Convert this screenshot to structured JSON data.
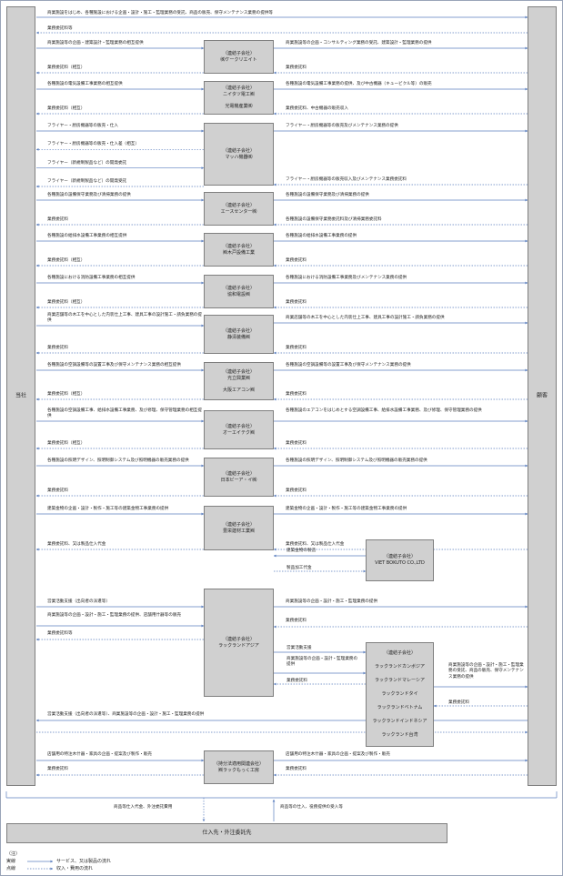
{
  "left_party": "当社",
  "right_party": "顧客",
  "blocks": [
    {
      "box": [],
      "left": [],
      "right": [],
      "top": [
        "商業施設をはじめ、各種施設における企画・設計・施工・監理業務の受託、商品の販売、保守メンテナンス業務の提供等"
      ],
      "bottom": [
        "業務委託料等"
      ]
    },
    {
      "box": [
        "（連結子会社）",
        "㈱ケークリエイト"
      ],
      "left": [
        "商業施設等の企画・建築設計・監理業務の相互提供",
        "業務委託料（相互）"
      ],
      "right": [
        "商業施設等の企画・コンサルティング業務の受託、建築設計・監理業務の提供",
        "業務委託料"
      ]
    },
    {
      "box": [
        "（連結子会社）",
        "ニイタツ電工㈱",
        "",
        "光電機産業㈱"
      ],
      "left": [
        "各種施設の電気設備工事業務の相互提供",
        "業務委託料（相互）"
      ],
      "right": [
        "各種施設の電気設備工事業務の提供、及び中古機器（キュービクル等）の販売",
        "業務委託料、中古機器の販売収入"
      ]
    },
    {
      "box": [
        "（連結子会社）",
        "マッハ機器㈱"
      ],
      "left": [
        "フライヤー・厨房機器等の販売・仕入",
        "フライヤー・厨房機器等の販売・仕入差（相互）",
        "フライヤー（新規制製品など）の開発委託",
        "フライヤー（新規制製品など）の開発受託"
      ],
      "right": [
        "フライヤー・厨房機器等の販売及びメンテナンス業務の提供",
        "フライヤー・厨房機器等の販売収入及びメンテナンス業務委託料"
      ]
    },
    {
      "box": [
        "（連結子会社）",
        "エースセンター㈱"
      ],
      "left": [
        "各種施設の設備保守業務及び清掃業務の提供",
        "業務委託料"
      ],
      "right": [
        "各種施設の設備保守業務及び清掃業務の提供",
        "各種施設の設備保守業務委託料及び清掃業務委託料"
      ]
    },
    {
      "box": [
        "（連結子会社）",
        "㈱木戸設備工業"
      ],
      "left": [
        "各種施設の給排水設備工事業務の相互提供",
        "業務委託料（相互）"
      ],
      "right": [
        "各種施設の給排水設備工事業務の提供",
        "業務委託料"
      ]
    },
    {
      "box": [
        "（連結子会社）",
        "協和電設㈱"
      ],
      "left": [
        "各種施設における消防設備工事業務の相互提供",
        "業務委託料（相互）"
      ],
      "right": [
        "各種施設における消防設備工事業務及びメンテナンス業務の提供",
        "業務委託料"
      ]
    },
    {
      "box": [
        "（連結子会社）",
        "静清装備㈱"
      ],
      "left": [
        "商業店舗等の木工を中心とした内装仕上工事、建具工事の設計施工・請負業務の提供",
        "業務委託料"
      ],
      "right": [
        "商業店舗等の木工を中心とした内装仕上工事、建具工事の設計施工・請負業務の提供",
        "業務委託料"
      ]
    },
    {
      "box": [
        "（連結子会社）",
        "光立興業㈱",
        "",
        "大阪エアコン㈱"
      ],
      "left": [
        "各種施設の空調設備等の設置工事及び保守メンテナンス業務の相互提供",
        "業務委託料（相互）"
      ],
      "right": [
        "各種施設の空調設備等の設置工事及び保守メンテナンス業務の提供",
        "業務委託料"
      ]
    },
    {
      "box": [
        "（連結子会社）",
        "オーエイテク㈱"
      ],
      "left": [
        "各種施設の空調設備工事、給排水設備工事業務、及び修理、保守管理業務の相互提供",
        "業務委託料（相互）"
      ],
      "right": [
        "各種施設のエアコンをはじめとする空調設備工事、給排水設備工事業務、及び修理、保守管理業務の提供",
        "業務委託料"
      ]
    },
    {
      "box": [
        "（連結子会社）",
        "日本ビーア・イ㈱"
      ],
      "left": [
        "各種施設の照明デザイン、照明制御システム及び照明機器の販売業務の提供",
        "業務委託料"
      ],
      "right": [
        "各種施設の照明デザイン、照明制御システム及び照明機器の販売業務の提供",
        "業務委託料"
      ]
    },
    {
      "box": [
        "（連結子会社）",
        "豊栄建材工業㈱"
      ],
      "left": [
        "建築金物の企画・設計・製作・施工等の建築金物工事業務の提供",
        "業務委託料、又は製品仕入代金"
      ],
      "right": [
        "建築金物の企画・設計・製作・施工等の建築金物工事業務の提供",
        "業務委託料、又は製品仕入代金"
      ]
    },
    {
      "box": [
        "（連結子会社）",
        "ラックランドアジア"
      ],
      "left": [
        "営業活動支援（出向者の派遣等）",
        "商業施設等の企画・設計・施工・監理業務の提供、店舗用什器等の販売",
        "業務委託料等",
        "営業活動支援（出向者の派遣等）、商業施設等の企画・設計・施工・監理業務の提供"
      ],
      "right": [
        "商業施設等の企画・設計・施工・監理業務の提供",
        "業務委託料"
      ]
    },
    {
      "box": [
        "（持分法適用関連会社）",
        "㈱ラックもっく工房"
      ],
      "left": [
        "店舗用の特注木什器・家具の企画・提案及び製作・販売",
        "業務委託料"
      ],
      "right": [
        "店舗用の特注木什器・家具の企画・提案及び製作・販売",
        "業務委託料"
      ]
    }
  ],
  "viet_box": {
    "lines": [
      "（連結子会社）",
      "VIET BOKUTO CO.,LTD"
    ],
    "label_service": "建築金物の製造",
    "label_payment": "製品加工代金"
  },
  "asia_subs": {
    "lines": [
      "（連結子会社）",
      "ラックランドカンボジア",
      "ラックランドマレーシア",
      "ラックランドタイ",
      "ラックランドベトナム",
      "ラックランドインドネシア",
      "ラックランド台湾"
    ],
    "label_in_1": "営業活動支援",
    "label_in_2": "商業施設等の企画・設計・監理業務の提供",
    "label_in_3": "業務委託料",
    "label_out_service": "商業施設等の企画・設計・施工・監理業務の受託、商品の販売、保守メンテナンス業務の提供",
    "label_out_payment": "業務委託料"
  },
  "suppliers": {
    "name": "仕入先・外注委託先",
    "label_payment": "商品等仕入代金、外注委託費用",
    "label_goods": "商品等の仕入、役務提供の受入等"
  },
  "legend": {
    "title": "（注）",
    "solid_name": "実線",
    "solid_desc": "サービス、又は製品の流れ",
    "dotted_name": "点線",
    "dotted_desc": "収入・費用の流れ"
  },
  "colors": {
    "arrow": "#5b7fbf",
    "box_fill": "#d0d0d0",
    "box_border": "#7f7f7f"
  }
}
